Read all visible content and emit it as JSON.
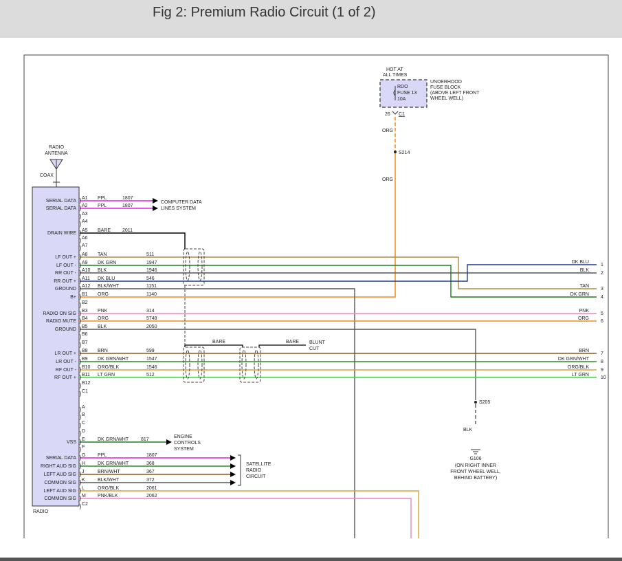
{
  "header": {
    "title": "Fig 2: Premium Radio Circuit (1 of 2)"
  },
  "antenna": {
    "label": [
      "RADIO",
      "ANTENNA"
    ],
    "coax": "COAX"
  },
  "radio": {
    "label": "RADIO"
  },
  "fuse": {
    "hot": [
      "HOT AT",
      "ALL TIMES"
    ],
    "box": [
      "RDO",
      "FUSE 13",
      "10A"
    ],
    "block": [
      "UNDERHOOD",
      "FUSE BLOCK",
      "(ABOVE LEFT FRONT",
      "WHEEL WELL)"
    ],
    "pin": "26",
    "conn": "C1",
    "wire_color_1": "ORG",
    "splice": "S214",
    "wire_color_2": "ORG"
  },
  "pins": [
    {
      "name": "SERIAL DATA",
      "pin": "A1",
      "color": "PPL",
      "circuit": "1807"
    },
    {
      "name": "SERIAL DATA",
      "pin": "A2",
      "color": "PPL",
      "circuit": "1807"
    },
    {
      "name": "",
      "pin": "A3",
      "color": "",
      "circuit": ""
    },
    {
      "name": "",
      "pin": "A4",
      "color": "",
      "circuit": ""
    },
    {
      "name": "DRAIN WIRE",
      "pin": "A5",
      "color": "BARE",
      "circuit": "2011"
    },
    {
      "name": "",
      "pin": "A6",
      "color": "",
      "circuit": ""
    },
    {
      "name": "",
      "pin": "A7",
      "color": "",
      "circuit": ""
    },
    {
      "name": "LF OUT +",
      "pin": "A8",
      "color": "TAN",
      "circuit": "511"
    },
    {
      "name": "LF OUT -",
      "pin": "A9",
      "color": "DK GRN",
      "circuit": "1947"
    },
    {
      "name": "RR OUT -",
      "pin": "A10",
      "color": "BLK",
      "circuit": "1946"
    },
    {
      "name": "RR OUT +",
      "pin": "A11",
      "color": "DK BLU",
      "circuit": "546"
    },
    {
      "name": "GROUND",
      "pin": "A12",
      "color": "BLK/WHT",
      "circuit": "1151"
    },
    {
      "name": "B+",
      "pin": "B1",
      "color": "ORG",
      "circuit": "1140"
    },
    {
      "name": "",
      "pin": "B2",
      "color": "",
      "circuit": ""
    },
    {
      "name": "RADIO ON SIG",
      "pin": "B3",
      "color": "PNK",
      "circuit": "314"
    },
    {
      "name": "RADIO MUTE",
      "pin": "B4",
      "color": "ORG",
      "circuit": "5748"
    },
    {
      "name": "GROUND",
      "pin": "B5",
      "color": "BLK",
      "circuit": "2050"
    },
    {
      "name": "",
      "pin": "B6",
      "color": "",
      "circuit": ""
    },
    {
      "name": "",
      "pin": "B7",
      "color": "",
      "circuit": ""
    },
    {
      "name": "LR OUT +",
      "pin": "B8",
      "color": "BRN",
      "circuit": "599"
    },
    {
      "name": "LR OUT -",
      "pin": "B9",
      "color": "DK GRN/WHT",
      "circuit": "1547"
    },
    {
      "name": "RF OUT -",
      "pin": "B10",
      "color": "ORG/BLK",
      "circuit": "1546"
    },
    {
      "name": "RF OUT +",
      "pin": "B11",
      "color": "LT GRN",
      "circuit": "512"
    },
    {
      "name": "",
      "pin": "B12",
      "color": "",
      "circuit": ""
    },
    {
      "name": "",
      "pin": "C1",
      "color": "",
      "circuit": ""
    },
    {
      "name": "",
      "pin": "A",
      "color": "",
      "circuit": ""
    },
    {
      "name": "",
      "pin": "B",
      "color": "",
      "circuit": ""
    },
    {
      "name": "",
      "pin": "C",
      "color": "",
      "circuit": ""
    },
    {
      "name": "",
      "pin": "D",
      "color": "",
      "circuit": ""
    },
    {
      "name": "VSS",
      "pin": "E",
      "color": "DK GRN/WHT",
      "circuit": "817"
    },
    {
      "name": "",
      "pin": "F",
      "color": "",
      "circuit": ""
    },
    {
      "name": "SERIAL DATA",
      "pin": "G",
      "color": "PPL",
      "circuit": "1807"
    },
    {
      "name": "RIGHT AUD SIG",
      "pin": "H",
      "color": "DK GRN/WHT",
      "circuit": "368"
    },
    {
      "name": "LEFT AUD SIG",
      "pin": "J",
      "color": "BRN/WHT",
      "circuit": "367"
    },
    {
      "name": "COMMON SIG",
      "pin": "K",
      "color": "BLK/WHT",
      "circuit": "372"
    },
    {
      "name": "LEFT AUD SIG",
      "pin": "L",
      "color": "ORG/BLK",
      "circuit": "2061"
    },
    {
      "name": "COMMON SIG",
      "pin": "M",
      "color": "PNK/BLK",
      "circuit": "2062"
    },
    {
      "name": "",
      "pin": "C2",
      "color": "",
      "circuit": ""
    }
  ],
  "outputs": [
    {
      "label": "DK BLU",
      "num": "1"
    },
    {
      "label": "BLK",
      "num": "2"
    },
    {
      "label": "TAN",
      "num": "3"
    },
    {
      "label": "DK GRN",
      "num": "4"
    },
    {
      "label": "PNK",
      "num": "5"
    },
    {
      "label": "ORG",
      "num": "6"
    },
    {
      "label": "BRN",
      "num": "7"
    },
    {
      "label": "DK GRN/WHT",
      "num": "8"
    },
    {
      "label": "ORG/BLK",
      "num": "9"
    },
    {
      "label": "LT GRN",
      "num": "10"
    }
  ],
  "computer_data": [
    "COMPUTER DATA",
    "LINES SYSTEM"
  ],
  "engine_controls": [
    "ENGINE",
    "CONTROLS",
    "SYSTEM"
  ],
  "satellite": [
    "SATELLITE",
    "RADIO",
    "CIRCUIT"
  ],
  "shield": {
    "bare1": "BARE",
    "bare2": "BARE",
    "blunt": [
      "BLUNT",
      "CUT"
    ]
  },
  "ground": {
    "splice": "S205",
    "wire_color": "BLK",
    "label": "G106",
    "location": [
      "(ON RIGHT INNER",
      "FRONT WHEEL WELL,",
      "BEHIND BATTERY)"
    ]
  },
  "colors": {
    "ppl": "#e020e0",
    "bare": "#000000",
    "tan": "#b08a3c",
    "dk_grn": "#1e7a1e",
    "blk": "#555555",
    "dk_blu": "#1f3a93",
    "org": "#f28a1a",
    "pnk": "#e987c6",
    "brn": "#8a5a1a",
    "dk_grn_wht": "#2a8a2a",
    "org_blk": "#d9a33a",
    "lt_grn": "#33dd33",
    "radio_fill": "#d9d9f7",
    "fuse_fill": "#d9d9f7"
  }
}
